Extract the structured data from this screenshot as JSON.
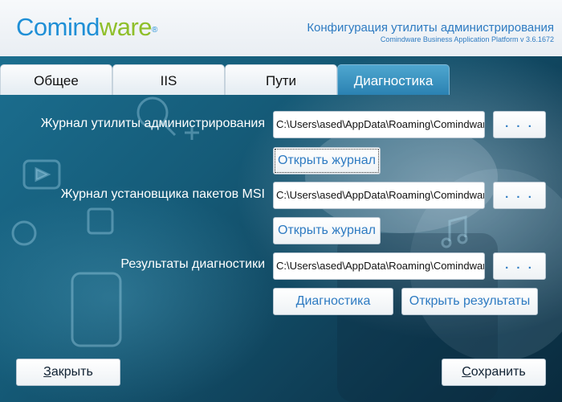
{
  "header": {
    "logo_part1": "Comind",
    "logo_part2": "ware",
    "logo_reg": "®",
    "title": "Конфигурация утилиты администрирования",
    "subtitle": "Comindware Business Application Platform v 3.6.1672"
  },
  "tabs": [
    {
      "label": "Общее",
      "active": false
    },
    {
      "label": "IIS",
      "active": false
    },
    {
      "label": "Пути",
      "active": false
    },
    {
      "label": "Диагностика",
      "active": true
    }
  ],
  "sections": {
    "admin_log": {
      "label": "Журнал утилиты администрирования",
      "path": "C:\\Users\\ased\\AppData\\Roaming\\Comindware",
      "browse_label": ". . .",
      "open_label": "Открыть журнал"
    },
    "msi_log": {
      "label": "Журнал установщика пакетов MSI",
      "path": "C:\\Users\\ased\\AppData\\Roaming\\Comindware",
      "browse_label": ". . .",
      "open_label": "Открыть журнал"
    },
    "diagnostics": {
      "label": "Результаты диагностики",
      "path": "C:\\Users\\ased\\AppData\\Roaming\\Comindware",
      "browse_label": ". . .",
      "run_label": "Диагностика",
      "open_results_label": "Открыть результаты"
    }
  },
  "footer": {
    "close_mnemonic": "З",
    "close_rest": "акрыть",
    "save_mnemonic": "С",
    "save_rest": "охранить"
  },
  "colors": {
    "accent": "#2e7bc2",
    "logo_blue": "#1f8fd6",
    "logo_green": "#8fbf2a",
    "active_tab": "#2b82b2",
    "background_dark": "#0f3f57"
  }
}
